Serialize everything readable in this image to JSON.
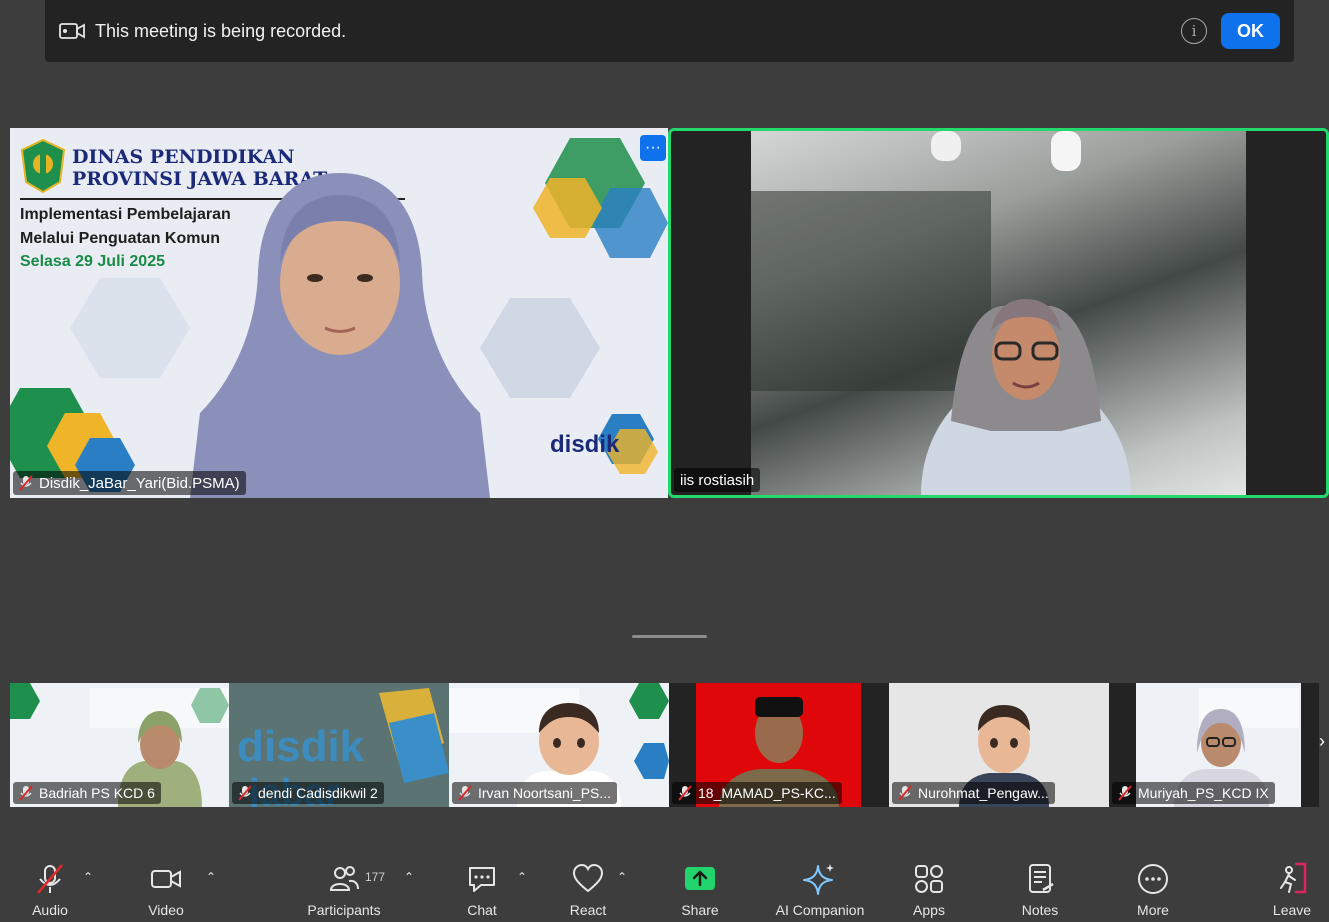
{
  "banner": {
    "text": "This meeting is being recorded.",
    "ok_label": "OK"
  },
  "main_tiles": [
    {
      "name": "Disdik_JaBar_Yari(Bid.PSMA)",
      "muted": true,
      "slide": {
        "title_line1": "DINAS PENDIDIKAN",
        "title_line2": "PROVINSI JAWA BARAT",
        "subtitle_line1": "Implementasi Pembelajaran",
        "subtitle_line2": "Melalui Penguatan Komun",
        "date": "Selasa 29 Juli 2025",
        "logo_text": "disdik"
      }
    },
    {
      "name": "iis rostiasih",
      "muted": false,
      "active_speaker": true
    }
  ],
  "more_label": "···",
  "thumbnails": [
    {
      "name": "Badriah PS KCD 6",
      "muted": true
    },
    {
      "name": "dendi Cadisdikwil 2",
      "muted": true
    },
    {
      "name": "Irvan Noortsani_PS...",
      "muted": true
    },
    {
      "name": "18_MAMAD_PS-KC...",
      "muted": true
    },
    {
      "name": "Nurohmat_Pengaw...",
      "muted": true
    },
    {
      "name": "Muriyah_PS_KCD IX",
      "muted": true
    }
  ],
  "strip_arrow": "›",
  "toolbar": {
    "audio": "Audio",
    "video": "Video",
    "participants": "Participants",
    "participants_count": "177",
    "chat": "Chat",
    "react": "React",
    "share": "Share",
    "ai_companion": "AI Companion",
    "apps": "Apps",
    "notes": "Notes",
    "more": "More",
    "leave": "Leave"
  },
  "colors": {
    "accent": "#0e72ed",
    "active_speaker_border": "#23d96d",
    "share_green": "#21d46b",
    "muted_red": "#e02828",
    "leave_red": "#e0245e"
  }
}
